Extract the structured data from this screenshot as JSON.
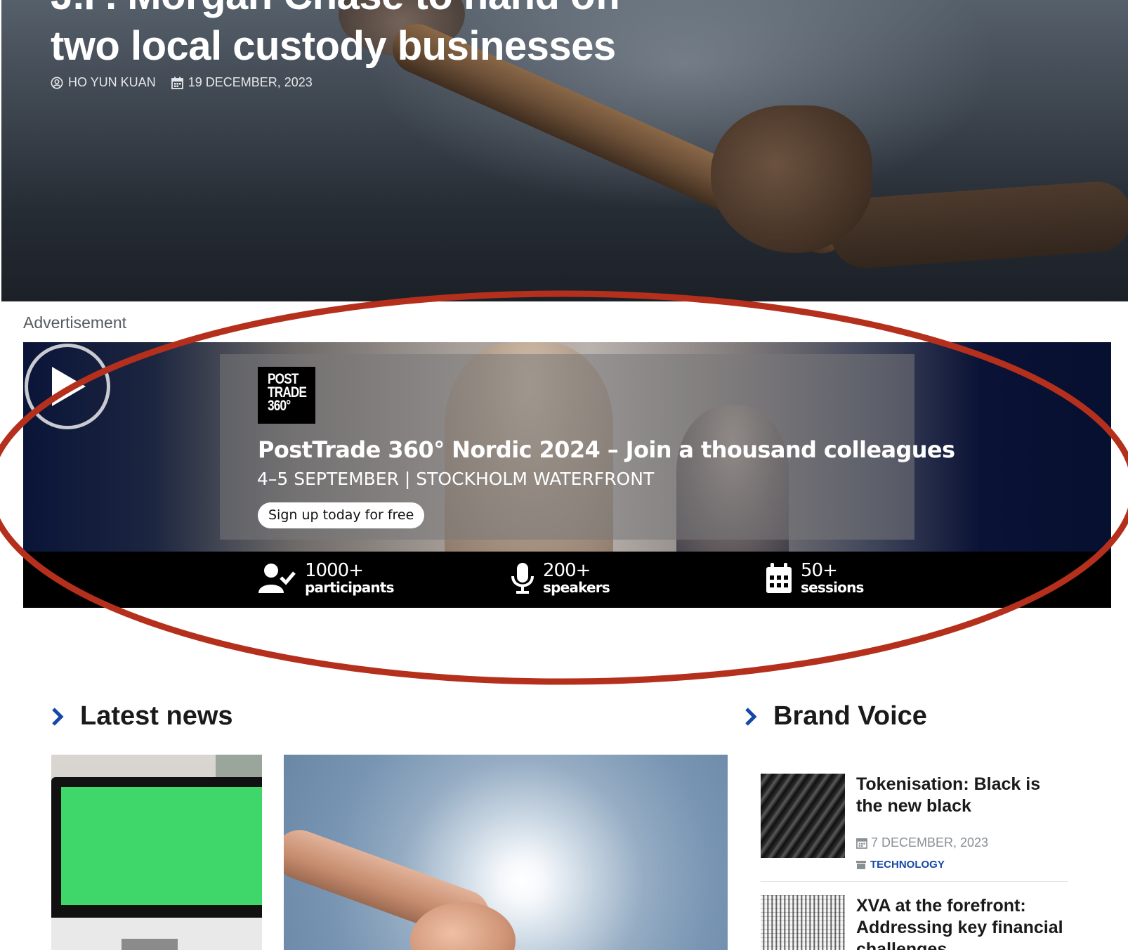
{
  "hero": {
    "title_line1": "J.P. Morgan Chase to hand off",
    "title_line2": "two local custody businesses",
    "author": "HO YUN KUAN",
    "date": "19 DECEMBER, 2023"
  },
  "advertisement": {
    "label": "Advertisement",
    "logo_lines": [
      "POST",
      "TRADE",
      "360°"
    ],
    "headline": "PostTrade 360° Nordic 2024 – Join a thousand colleagues",
    "subheadline": "4–5 SEPTEMBER | STOCKHOLM WATERFRONT",
    "cta": "Sign up today for free",
    "stats": [
      {
        "number": "1000+",
        "label": "participants",
        "icon": "user-check-icon"
      },
      {
        "number": "200+",
        "label": "speakers",
        "icon": "microphone-icon"
      },
      {
        "number": "50+",
        "label": "sessions",
        "icon": "calendar-icon"
      }
    ],
    "annotation_color": "#b5301c"
  },
  "latest_news": {
    "title": "Latest news",
    "accent": "#1447a8"
  },
  "brand_voice": {
    "title": "Brand Voice",
    "items": [
      {
        "title": "Tokenisation: Black is the new black",
        "date": "7 DECEMBER, 2023",
        "category": "TECHNOLOGY"
      },
      {
        "title": "XVA at the forefront: Addressing key financial challenges"
      }
    ]
  }
}
